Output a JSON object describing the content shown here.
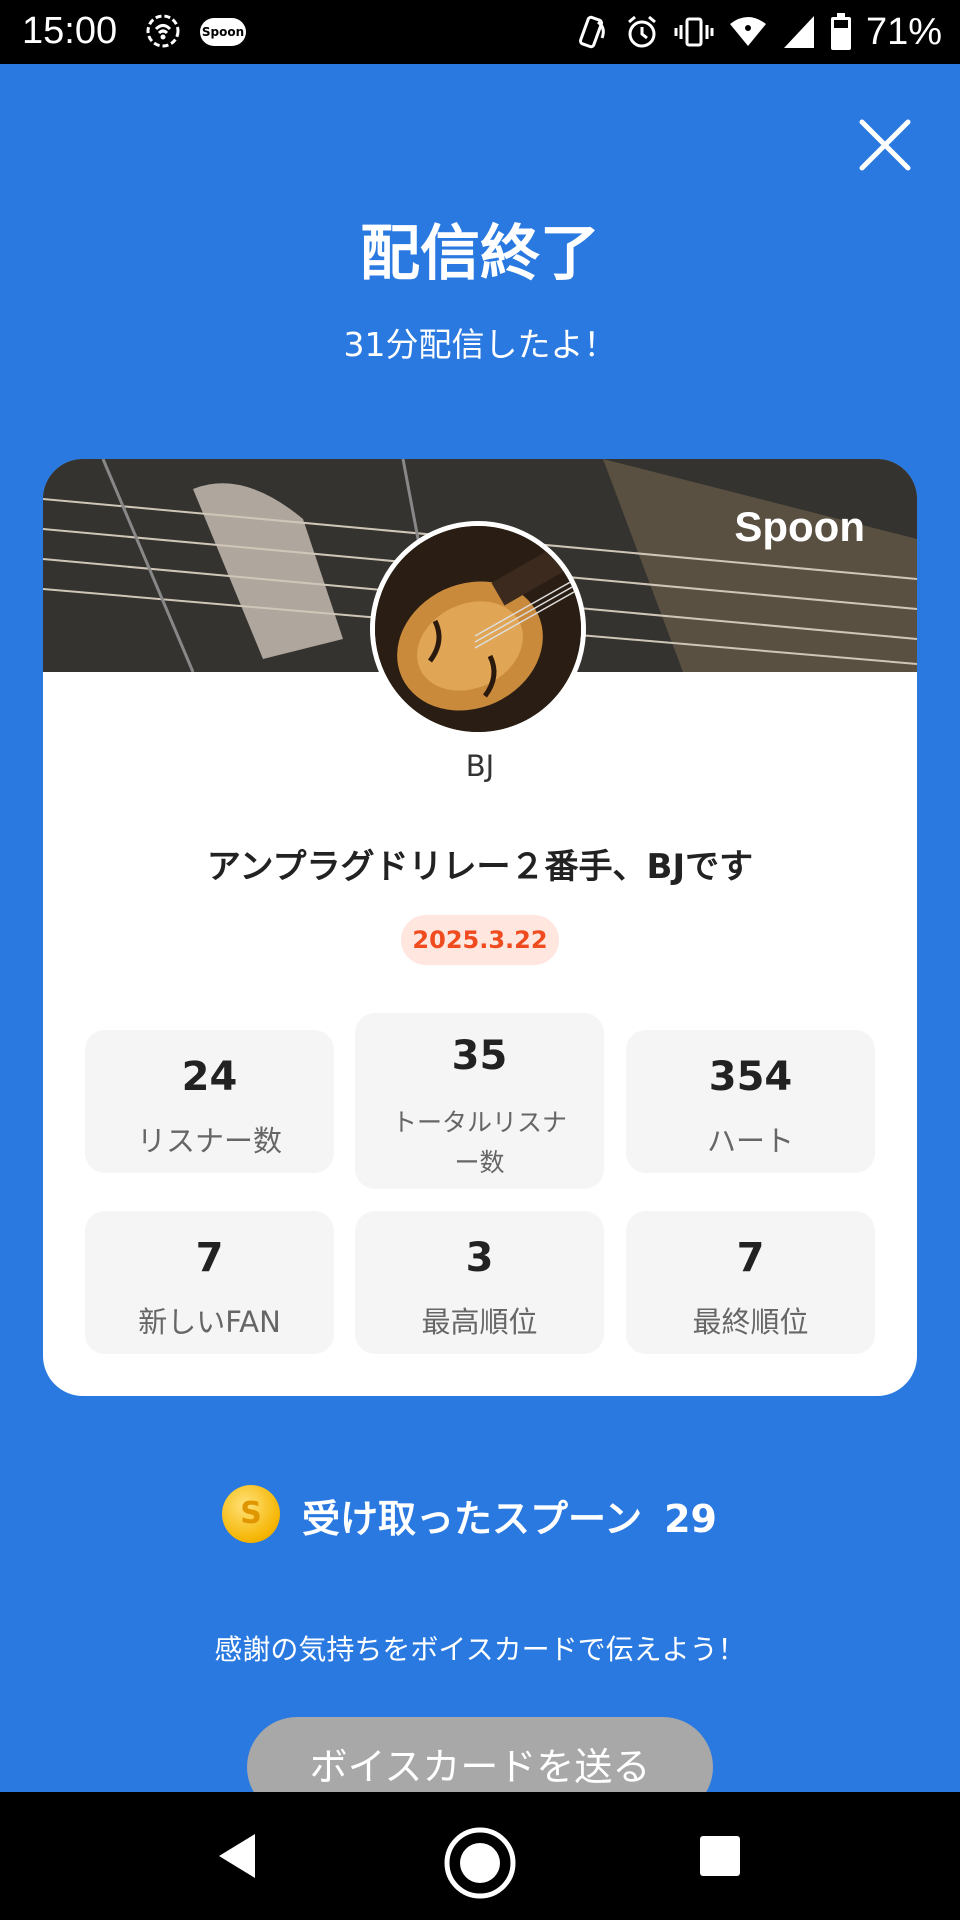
{
  "status_bar": {
    "time": "15:00",
    "app_badge": "Spoon",
    "battery": "71%",
    "icons": [
      "hotspot-icon",
      "spoon-app-icon",
      "nfc-icon",
      "alarm-icon",
      "vibrate-icon",
      "wifi-icon",
      "signal-icon",
      "battery-icon"
    ]
  },
  "header": {
    "title": "配信終了",
    "subtitle": "31分配信したよ！",
    "close_icon": "close-icon"
  },
  "card": {
    "brand": "Spoon",
    "username": "BJ",
    "stream_title": "アンプラグドリレー２番手、BJです",
    "date": "2025.3.22",
    "stats": [
      {
        "value": "24",
        "label": "リスナー数"
      },
      {
        "value": "35",
        "label": "トータルリスナー数"
      },
      {
        "value": "354",
        "label": "ハート"
      },
      {
        "value": "7",
        "label": "新しいFAN"
      },
      {
        "value": "3",
        "label": "最高順位"
      },
      {
        "value": "7",
        "label": "最終順位"
      }
    ]
  },
  "spoons": {
    "coin_letter": "S",
    "label": "受け取ったスプーン",
    "count": "29"
  },
  "thanks_text": "感謝の気持ちをボイスカードで伝えよう！",
  "send_button": "ボイスカードを送る",
  "colors": {
    "background": "#2979e0",
    "date_text": "#f04a1f",
    "date_bg": "#ffe6df",
    "button_disabled": "#a8a8a8"
  }
}
